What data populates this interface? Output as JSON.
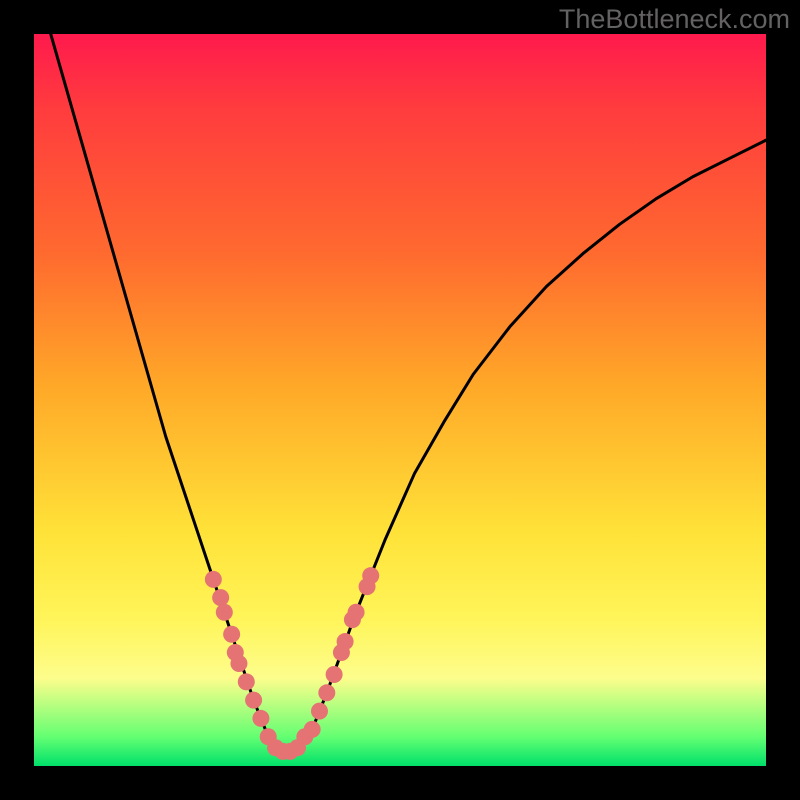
{
  "watermark": "TheBottleneck.com",
  "colors": {
    "background": "#000000",
    "curve": "#000000",
    "dots": "#e57373",
    "gradient_top": "#ff1a4d",
    "gradient_bottom": "#00e06a"
  },
  "chart_data": {
    "type": "line",
    "title": "",
    "xlabel": "",
    "ylabel": "",
    "xlim": [
      0,
      100
    ],
    "ylim": [
      0,
      100
    ],
    "grid": false,
    "annotations": [
      "TheBottleneck.com"
    ],
    "series": [
      {
        "name": "bottleneck-curve",
        "x": [
          0,
          2,
          4,
          6,
          8,
          10,
          12,
          14,
          16,
          18,
          20,
          22,
          24,
          26,
          28,
          30,
          32,
          33,
          34,
          35,
          36,
          38,
          40,
          42,
          44,
          46,
          48,
          52,
          56,
          60,
          65,
          70,
          75,
          80,
          85,
          90,
          95,
          100
        ],
        "y": [
          108,
          101,
          94,
          87,
          80,
          73,
          66,
          59,
          52,
          45,
          39,
          33,
          27,
          21,
          15,
          9,
          4,
          2.5,
          2,
          2,
          2.5,
          5,
          10,
          15.5,
          21,
          26,
          31,
          40,
          47,
          53.5,
          60,
          65.5,
          70,
          74,
          77.5,
          80.5,
          83,
          85.5
        ]
      }
    ],
    "highlight_points": {
      "name": "highlighted-range",
      "x": [
        24.5,
        25.5,
        26,
        27,
        27.5,
        28,
        29,
        30,
        31,
        32,
        33,
        34,
        35,
        36,
        37,
        38,
        39,
        40,
        41,
        42,
        42.5,
        43.5,
        44,
        45.5,
        46
      ],
      "y": [
        25.5,
        23,
        21,
        18,
        15.5,
        14,
        11.5,
        9,
        6.5,
        4,
        2.5,
        2,
        2,
        2.5,
        4,
        5,
        7.5,
        10,
        12.5,
        15.5,
        17,
        20,
        21,
        24.5,
        26
      ]
    }
  }
}
